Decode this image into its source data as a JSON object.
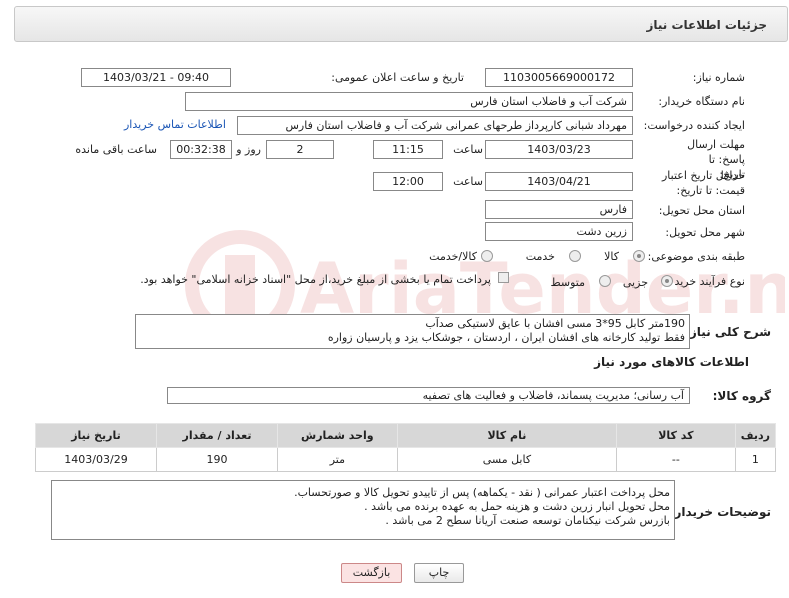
{
  "header": {
    "title": "جزئیات اطلاعات نیاز"
  },
  "fields": {
    "need_number_label": "شماره نیاز:",
    "need_number": "1103005669000172",
    "announce_label": "تاریخ و ساعت اعلان عمومی:",
    "announce_value": "1403/03/21 - 09:40",
    "buyer_label": "نام دستگاه خریدار:",
    "buyer_value": "شرکت آب و فاضلاب استان فارس",
    "creator_label": "ایجاد کننده درخواست:",
    "creator_value": "مهرداد شبانی کارپرداز طرحهای عمرانی  شرکت آب و فاضلاب استان فارس",
    "contact_link": "اطلاعات تماس خریدار",
    "deadline_label": "مهلت ارسال پاسخ: تا تاریخ:",
    "deadline_date": "1403/03/23",
    "time_label": "ساعت",
    "deadline_time": "11:15",
    "days_value": "2",
    "days_label": "روز و",
    "remaining_value": "00:32:38",
    "remaining_label": "ساعت باقی مانده",
    "validity_label": "حداقل تاریخ اعتبار قیمت: تا تاریخ:",
    "validity_date": "1403/04/21",
    "validity_time_label": "ساعت",
    "validity_time": "12:00",
    "province_label": "استان محل تحویل:",
    "province_value": "فارس",
    "city_label": "شهر محل تحویل:",
    "city_value": "زرین دشت",
    "category_label": "طبقه بندی موضوعی:",
    "category_options": [
      "کالا",
      "خدمت",
      "کالا/خدمت"
    ],
    "process_label": "نوع فرآیند خرید :",
    "process_options": [
      "جزیی",
      "متوسط"
    ],
    "payment_note": "پرداخت تمام یا بخشی از مبلغ خرید،از محل \"اسناد خزانه اسلامی\" خواهد بود."
  },
  "summary": {
    "label": "شرح کلی نیاز:",
    "lines": [
      "190متر کابل 95*3 مسی افشان با عایق لاستیکی صدآب",
      "فقط تولید کارخانه های افشان ایران ، اردستان ، جوشکاب یزد و پارسیان زواره"
    ]
  },
  "goods": {
    "section_title": "اطلاعات کالاهای مورد نیاز",
    "group_label": "گروه کالا:",
    "group_value": "آب رسانی؛ مدیریت پسماند، فاضلاب و فعالیت های تصفیه"
  },
  "table": {
    "headers": [
      "ردیف",
      "کد کالا",
      "نام کالا",
      "واحد شمارش",
      "تعداد / مقدار",
      "تاریخ نیاز"
    ],
    "rows": [
      [
        "1",
        "--",
        "کابل مسی",
        "متر",
        "190",
        "1403/03/29"
      ]
    ]
  },
  "buyer_notes": {
    "label": "توضیحات خریدار:",
    "lines": [
      "محل پرداخت اعتبار عمرانی  ( نقد - یکماهه) پس از تاییدو تحویل کالا و صورتحساب.",
      "محل تحویل انبار زرین دشت  و هزینه حمل به عهده برنده می باشد .",
      "بازرس شرکت نیکنامان توسعه صنعت آریانا سطح 2 می باشد ."
    ]
  },
  "buttons": {
    "print": "چاپ",
    "back": "بازگشت"
  },
  "watermark": {
    "text": "AriaTender.neT"
  }
}
